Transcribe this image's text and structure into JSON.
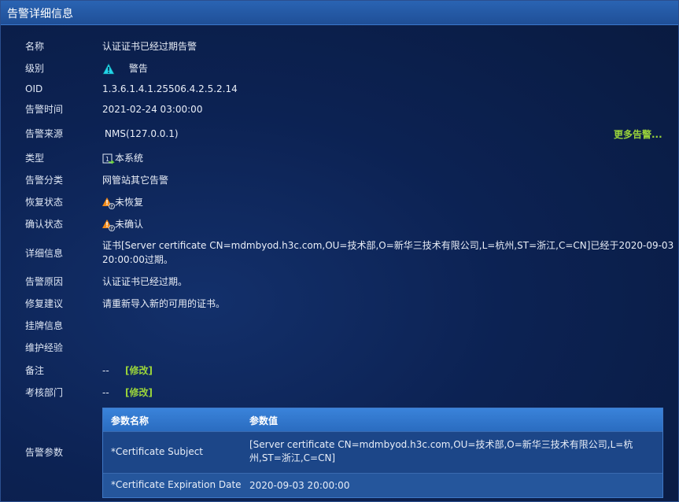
{
  "window": {
    "title": "告警详细信息"
  },
  "fields": {
    "name": {
      "label": "名称",
      "value": "认证证书已经过期告警"
    },
    "level": {
      "label": "级别",
      "value": "警告"
    },
    "oid": {
      "label": "OID",
      "value": "1.3.6.1.4.1.25506.4.2.5.2.14"
    },
    "time": {
      "label": "告警时间",
      "value": "2021-02-24 03:00:00"
    },
    "source": {
      "label": "告警来源",
      "value": "NMS(127.0.0.1)"
    },
    "type": {
      "label": "类型",
      "value": "本系统"
    },
    "category": {
      "label": "告警分类",
      "value": "网管站其它告警"
    },
    "recover": {
      "label": "恢复状态",
      "value": "未恢复"
    },
    "confirm": {
      "label": "确认状态",
      "value": "未确认"
    },
    "detail": {
      "label": "详细信息",
      "line1": "证书[Server certificate CN=mdmbyod.h3c.com,OU=技术部,O=新华三技术有限公司,L=杭州,ST=浙江,C=CN]已经于2020-09-03",
      "line2": "20:00:00过期。"
    },
    "reason": {
      "label": "告警原因",
      "value": "认证证书已经过期。"
    },
    "fix": {
      "label": "修复建议",
      "value": "请重新导入新的可用的证书。"
    },
    "tag": {
      "label": "挂牌信息"
    },
    "exp": {
      "label": "维护经验"
    },
    "remark": {
      "label": "备注",
      "value": "--",
      "edit": "[修改]"
    },
    "dept": {
      "label": "考核部门",
      "value": "--",
      "edit": "[修改]"
    },
    "params": {
      "label": "告警参数"
    }
  },
  "more_link": "更多告警...",
  "params_table": {
    "headers": [
      "参数名称",
      "参数值"
    ],
    "rows": [
      {
        "name": "*Certificate Subject",
        "value": "[Server certificate CN=mdmbyod.h3c.com,OU=技术部,O=新华三技术有限公司,L=杭州,ST=浙江,C=CN]"
      },
      {
        "name": "*Certificate Expiration Date",
        "value": "2020-09-03 20:00:00"
      }
    ]
  }
}
